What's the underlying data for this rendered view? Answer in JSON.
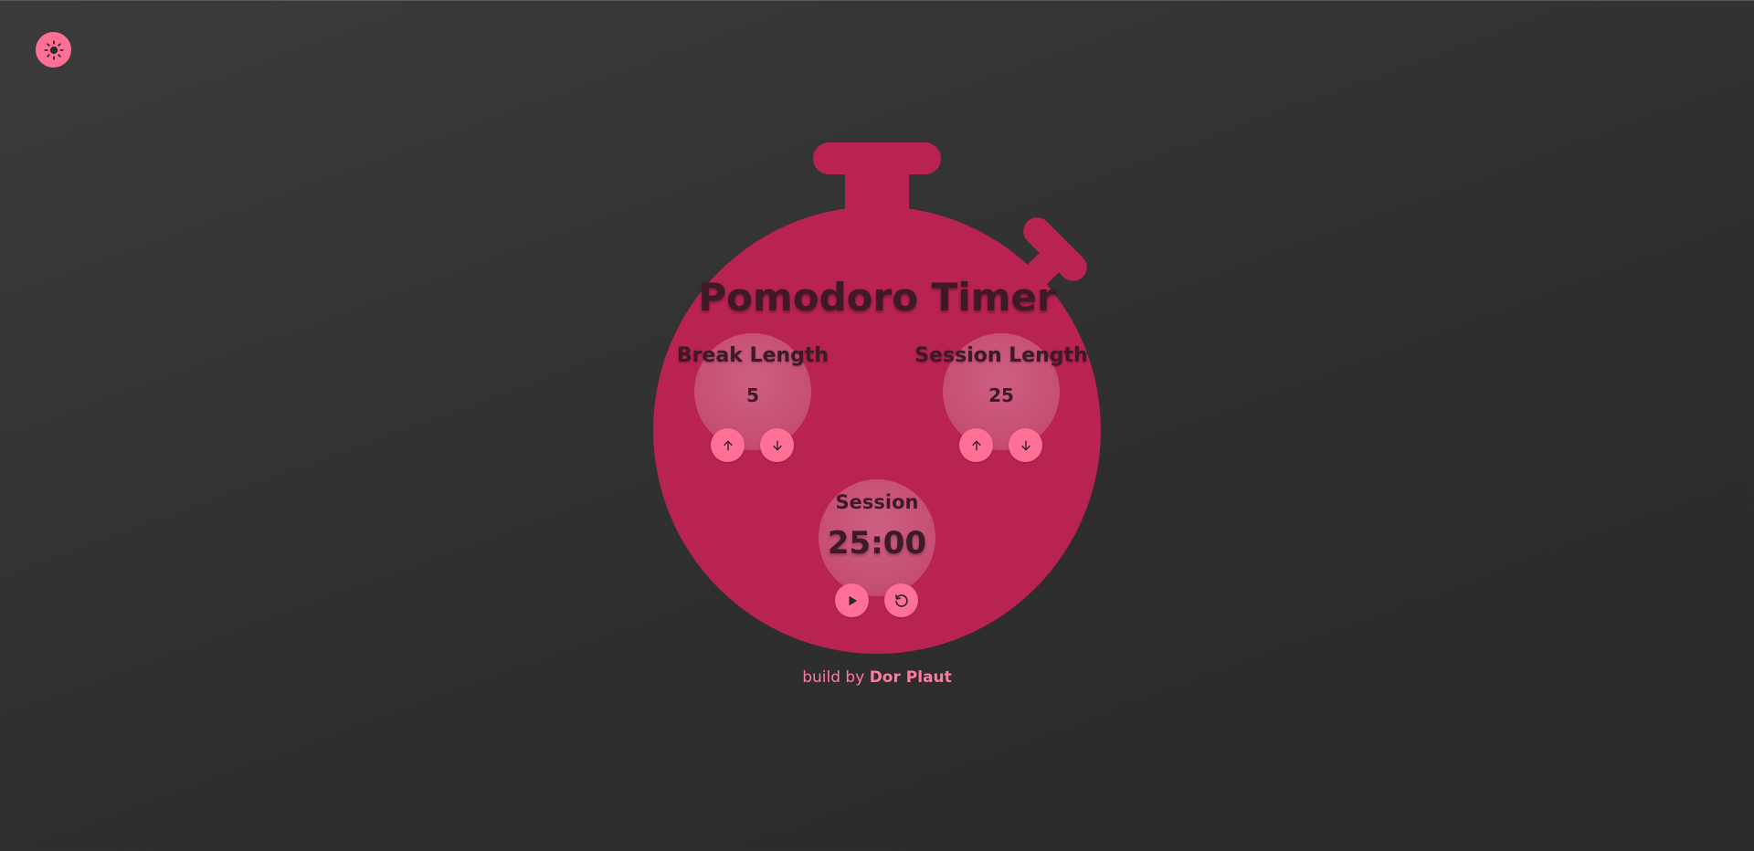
{
  "theme_toggle": {
    "icon": "sun-icon"
  },
  "title": "Pomodoro Timer",
  "break": {
    "label": "Break Length",
    "value": "5"
  },
  "session": {
    "label": "Session Length",
    "value": "25"
  },
  "timer": {
    "label": "Session",
    "time": "25:00"
  },
  "controls": {
    "increment_icon": "arrow-up-icon",
    "decrement_icon": "arrow-down-icon",
    "play_icon": "play-icon",
    "reset_icon": "reset-icon"
  },
  "footer": {
    "prefix": "build by",
    "author": "Dor Plaut"
  },
  "colors": {
    "background": "#333333",
    "watch": "#b92352",
    "button": "#ff6f96",
    "text": "#3d1a26"
  }
}
